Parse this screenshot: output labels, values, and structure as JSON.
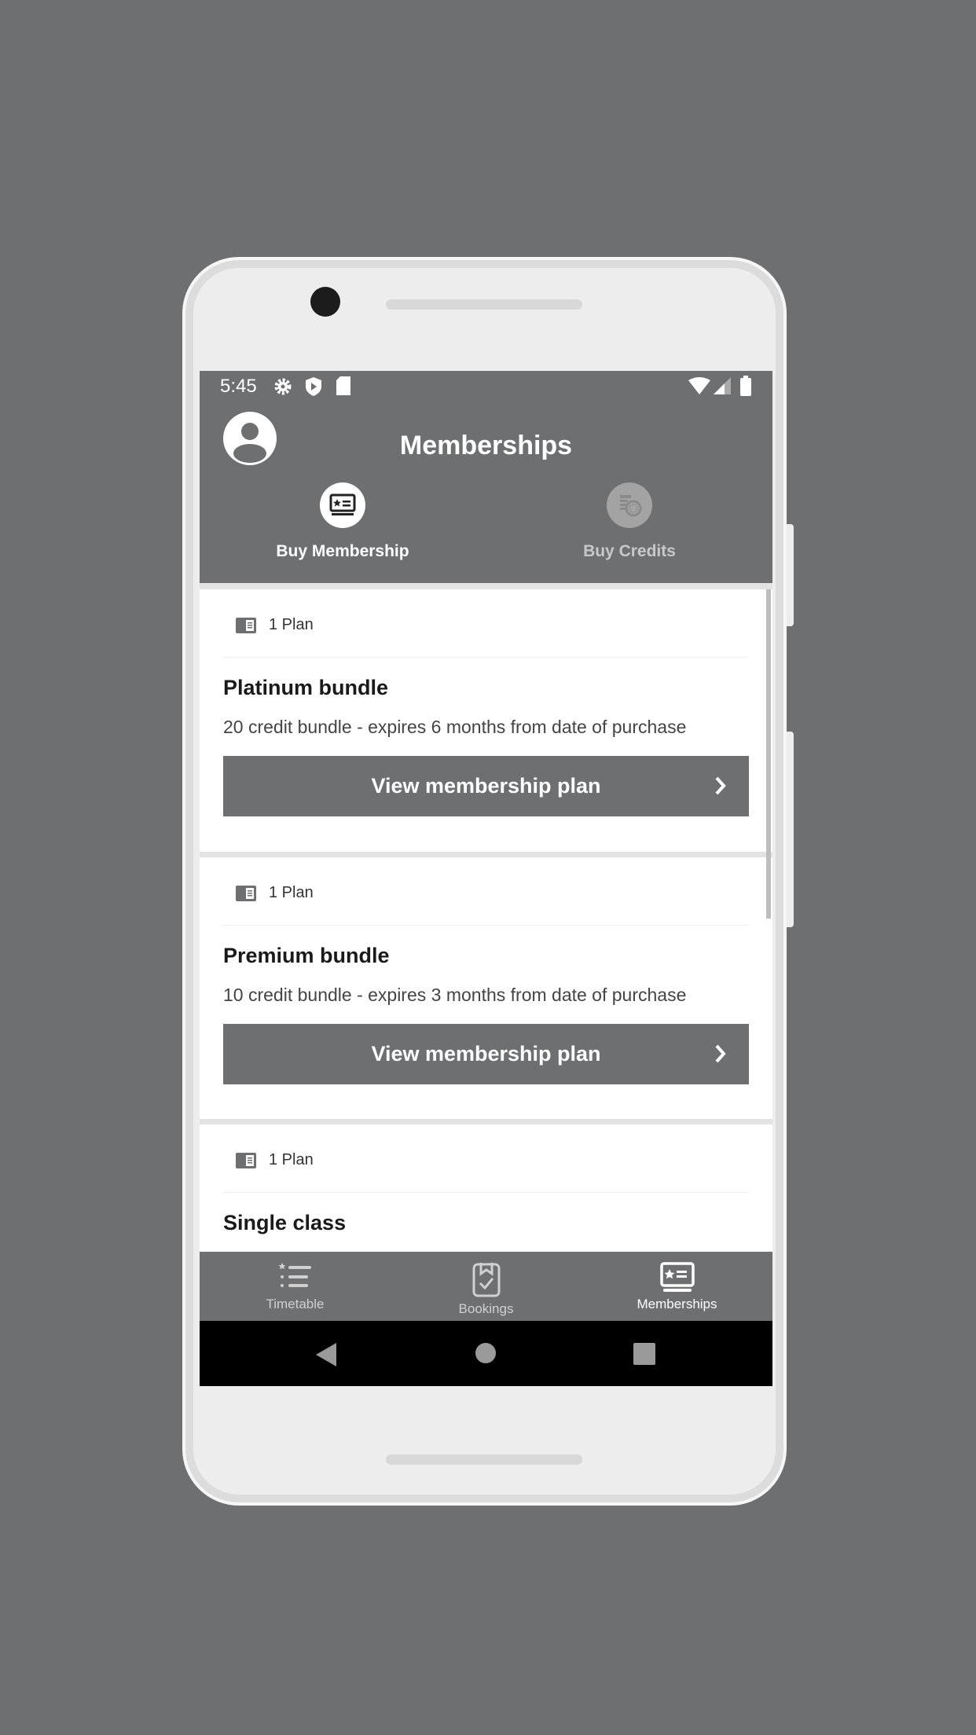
{
  "status_bar": {
    "time": "5:45"
  },
  "header": {
    "title": "Memberships"
  },
  "tabs": [
    {
      "label": "Buy Membership",
      "active": true
    },
    {
      "label": "Buy Credits",
      "active": false
    }
  ],
  "plans": [
    {
      "count": "1 Plan",
      "name": "Platinum bundle",
      "description": "20 credit bundle - expires 6 months from date of purchase",
      "button": "View membership plan"
    },
    {
      "count": "1 Plan",
      "name": "Premium bundle",
      "description": "10 credit bundle - expires 3 months from date of purchase",
      "button": "View membership plan"
    },
    {
      "count": "1 Plan",
      "name": "Single class"
    }
  ],
  "bottom_nav": [
    {
      "label": "Timetable",
      "icon": "list-star-icon"
    },
    {
      "label": "Bookings",
      "icon": "clipboard-check-icon"
    },
    {
      "label": "Memberships",
      "icon": "membership-card-icon",
      "active": true
    }
  ],
  "colors": {
    "primary": "#6e6f71",
    "background": "#6e6f71"
  }
}
